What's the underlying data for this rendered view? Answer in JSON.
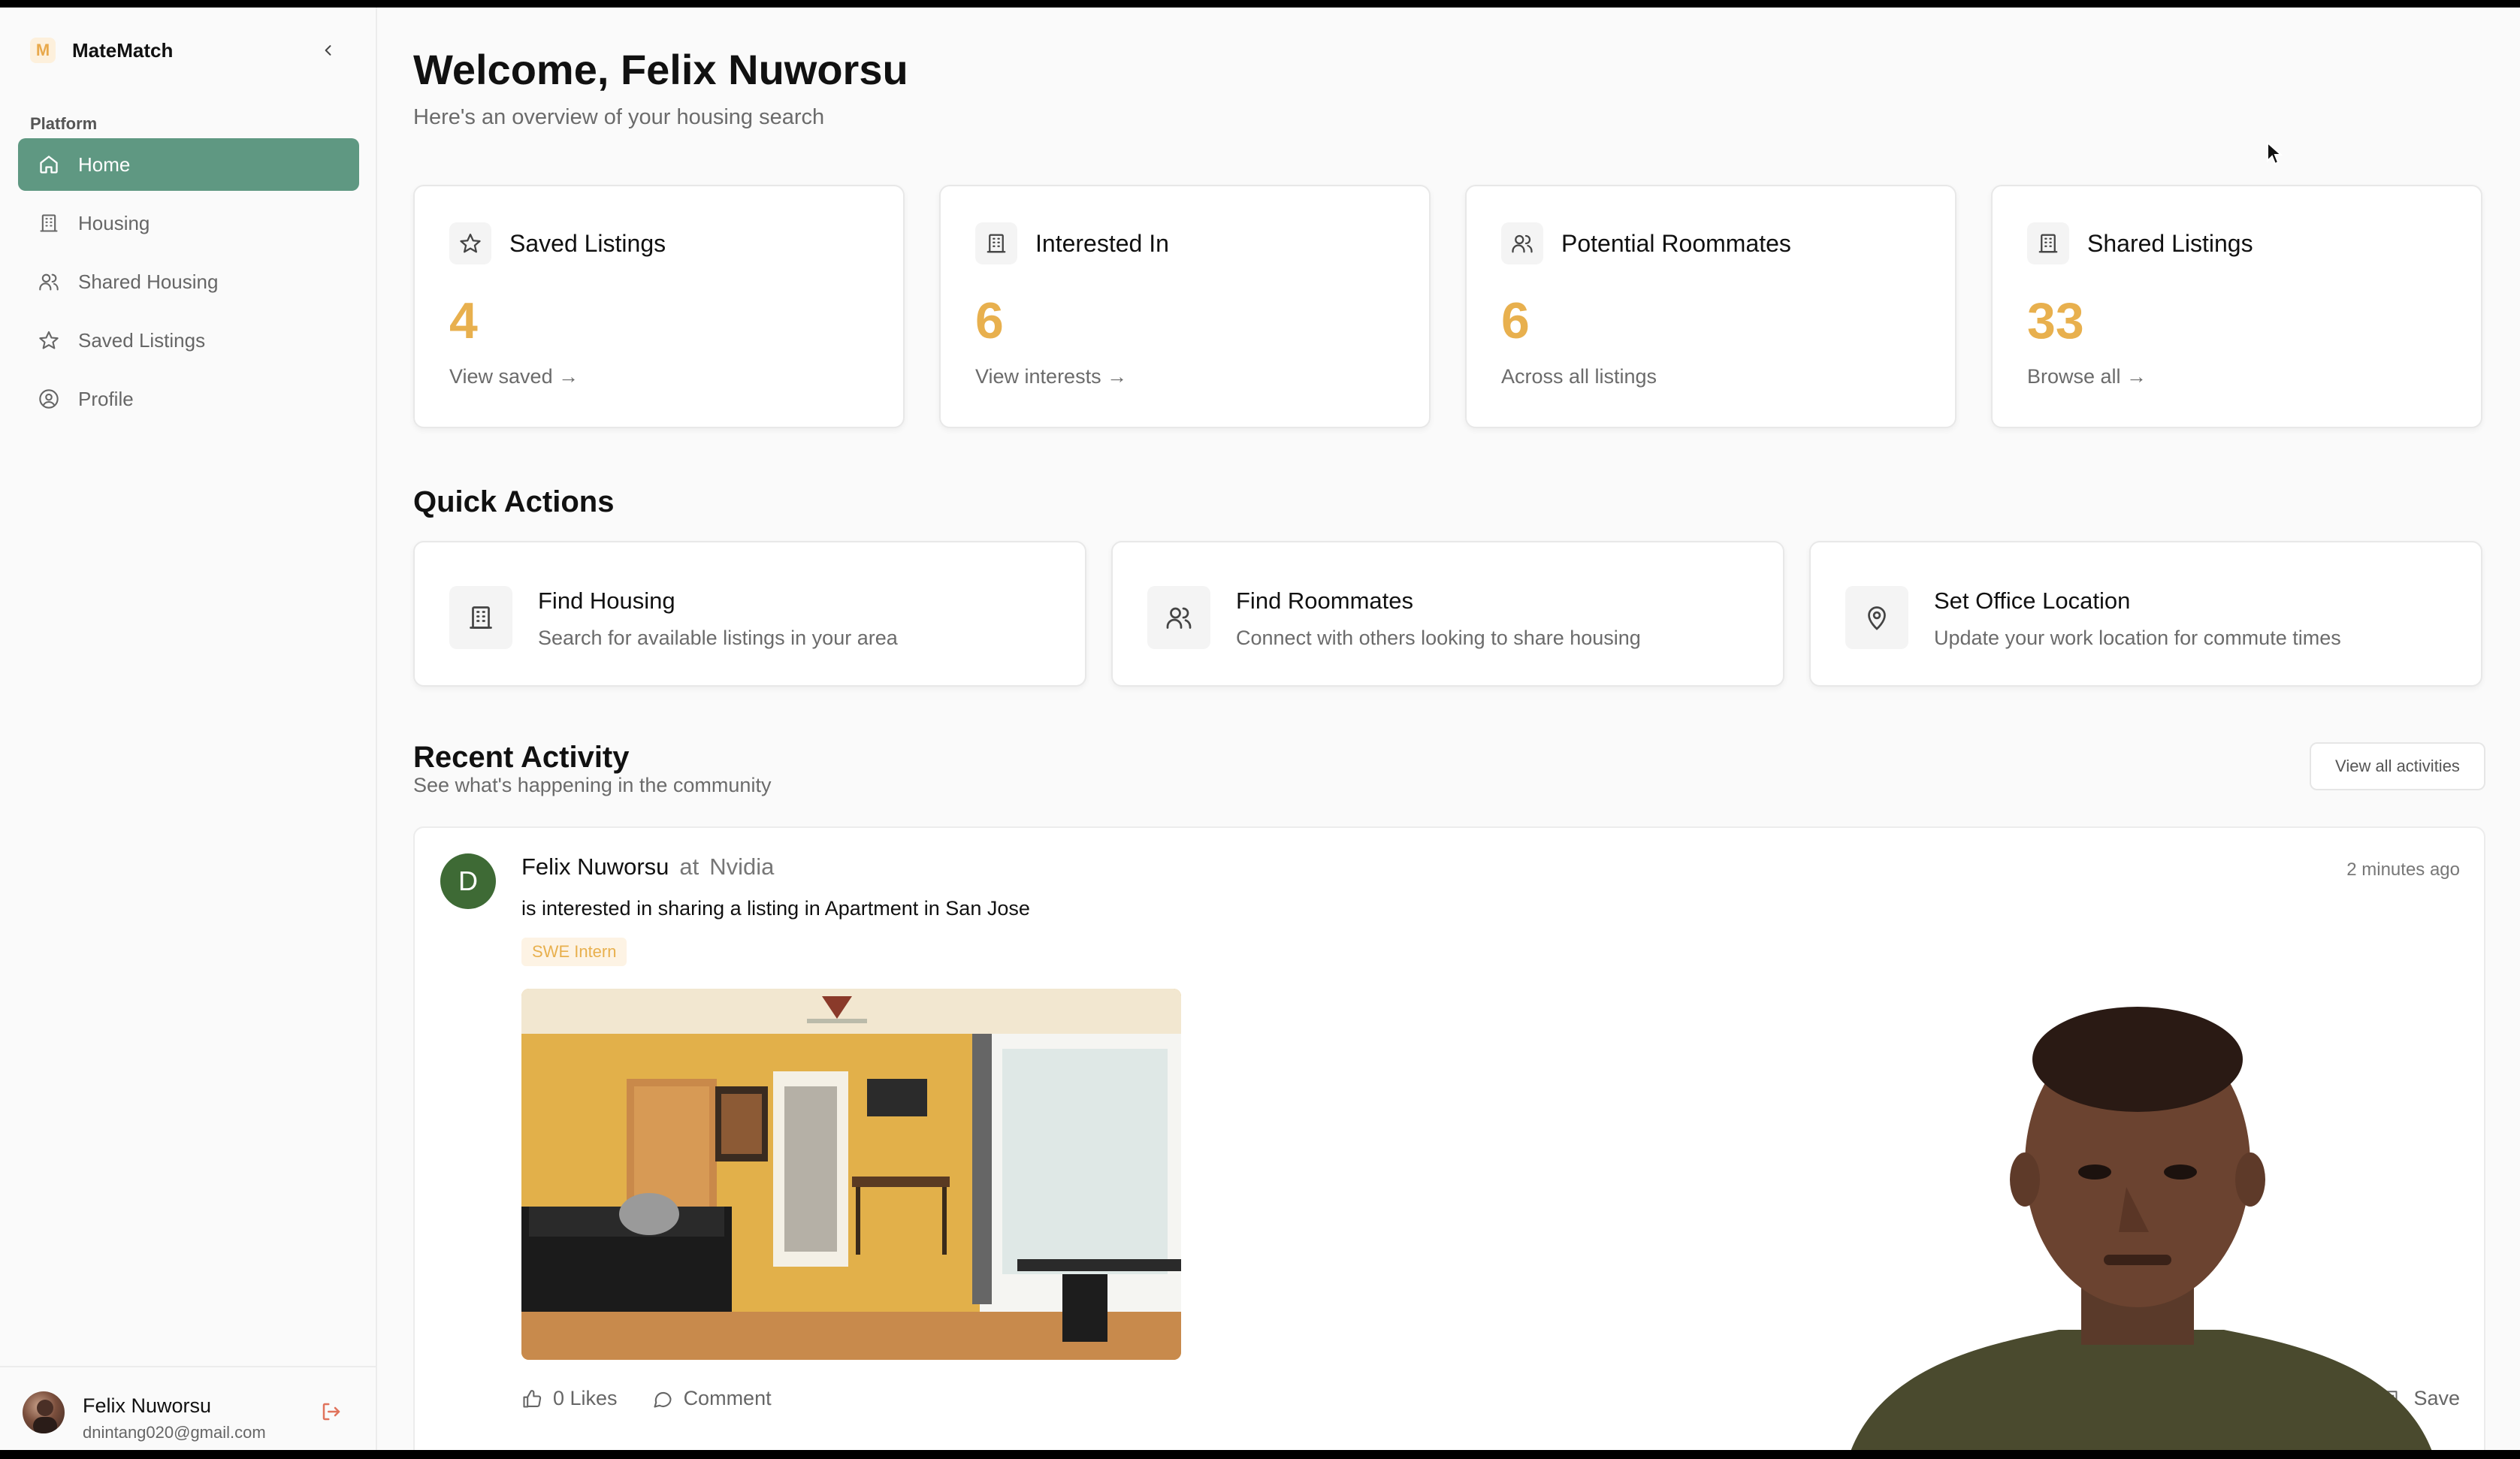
{
  "app": {
    "name": "MateMatch",
    "logo_letter": "M"
  },
  "sidebar": {
    "section_label": "Platform",
    "items": [
      {
        "label": "Home",
        "icon": "home-icon",
        "active": true
      },
      {
        "label": "Housing",
        "icon": "building-icon",
        "active": false
      },
      {
        "label": "Shared Housing",
        "icon": "users-icon",
        "active": false
      },
      {
        "label": "Saved Listings",
        "icon": "star-icon",
        "active": false
      },
      {
        "label": "Profile",
        "icon": "user-circle-icon",
        "active": false
      }
    ],
    "user": {
      "name": "Felix Nuworsu",
      "email": "dnintang020@gmail.com"
    }
  },
  "header": {
    "title": "Welcome, Felix Nuworsu",
    "subtitle": "Here's an overview of your housing search"
  },
  "stats": [
    {
      "title": "Saved Listings",
      "value": "4",
      "link": "View saved →",
      "icon": "star-icon"
    },
    {
      "title": "Interested In",
      "value": "6",
      "link": "View interests →",
      "icon": "building-icon"
    },
    {
      "title": "Potential Roommates",
      "value": "6",
      "link": "Across all listings",
      "icon": "users-icon"
    },
    {
      "title": "Shared Listings",
      "value": "33",
      "link": "Browse all →",
      "icon": "building-icon"
    }
  ],
  "quick_actions": {
    "title": "Quick Actions",
    "items": [
      {
        "title": "Find Housing",
        "desc": "Search for available listings in your area",
        "icon": "building-icon"
      },
      {
        "title": "Find Roommates",
        "desc": "Connect with others looking to share housing",
        "icon": "users-icon"
      },
      {
        "title": "Set Office Location",
        "desc": "Update your work location for commute times",
        "icon": "map-pin-icon"
      }
    ]
  },
  "recent_activity": {
    "title": "Recent Activity",
    "subtitle": "See what's happening in the community",
    "view_all": "View all activities",
    "items": [
      {
        "avatar_letter": "D",
        "name": "Felix Nuworsu",
        "at": "at",
        "company": "Nvidia",
        "text": "is interested in sharing a listing in Apartment in San Jose",
        "time": "2 minutes ago",
        "tag": "SWE Intern",
        "likes": "0 Likes",
        "comment": "Comment",
        "save": "Save"
      }
    ]
  },
  "colors": {
    "accent": "#5f9882",
    "stat_number": "#e8b04e",
    "avatar_bg": "#3e6a35"
  }
}
